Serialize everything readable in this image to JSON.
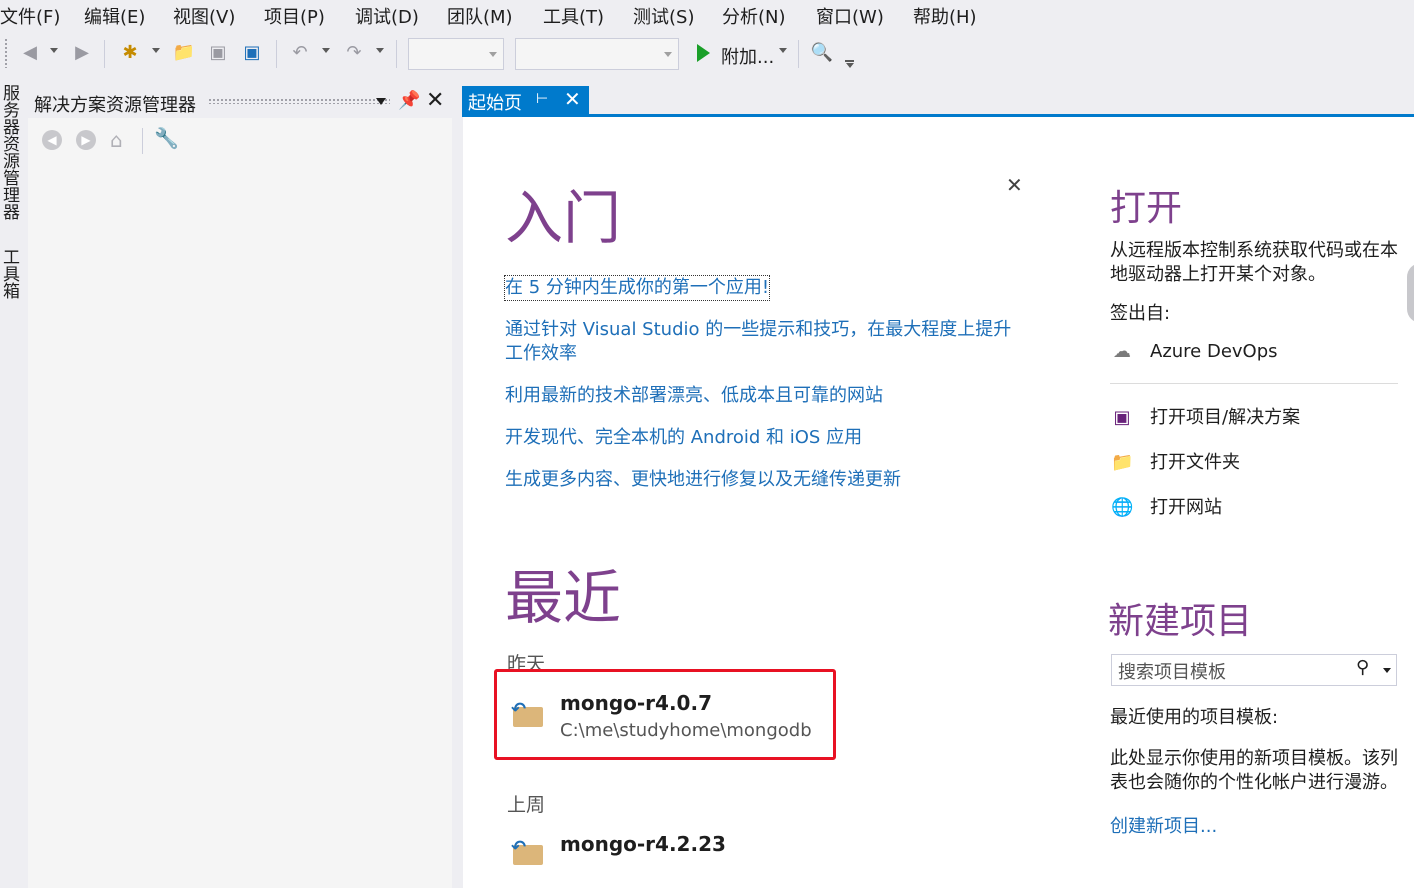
{
  "menu": [
    "文件(F)",
    "编辑(E)",
    "视图(V)",
    "项目(P)",
    "调试(D)",
    "团队(M)",
    "工具(T)",
    "测试(S)",
    "分析(N)",
    "窗口(W)",
    "帮助(H)"
  ],
  "toolbar": {
    "run_label": "附加..."
  },
  "left_strip": {
    "server_explorer": "服务器资源管理器",
    "toolbox": "工具箱"
  },
  "solution_explorer": {
    "title": "解决方案资源管理器"
  },
  "tab": {
    "label": "起始页"
  },
  "start": {
    "getting_started": {
      "heading": "入门",
      "links": [
        "在 5 分钟内生成你的第一个应用!",
        "通过针对 Visual Studio 的一些提示和技巧，在最大程度上提升",
        "工作效率",
        "利用最新的技术部署漂亮、低成本且可靠的网站",
        "开发现代、完全本机的 Android 和 iOS 应用",
        "生成更多内容、更快地进行修复以及无缝传递更新"
      ]
    },
    "recent": {
      "heading": "最近",
      "groups": [
        {
          "label": "昨天",
          "items": [
            {
              "name": "mongo-r4.0.7",
              "path": "C:\\me\\studyhome\\mongodb"
            }
          ]
        },
        {
          "label": "上周",
          "items": [
            {
              "name": "mongo-r4.2.23",
              "path": ""
            }
          ]
        }
      ]
    },
    "open": {
      "heading": "打开",
      "desc_line1": "从远程版本控制系统获取代码或在本",
      "desc_line2": "地驱动器上打开某个对象。",
      "checkout_label": "签出自:",
      "azure": "Azure DevOps",
      "actions": [
        "打开项目/解决方案",
        "打开文件夹",
        "打开网站"
      ]
    },
    "new_project": {
      "heading": "新建项目",
      "search_placeholder": "搜索项目模板",
      "recent_templates_label": "最近使用的项目模板:",
      "info_line1": "此处显示你使用的新项目模板。该列",
      "info_line2": "表也会随你的个性化帐户进行漫游。",
      "create_link": "创建新项目..."
    }
  },
  "colors": {
    "accent": "#007acc",
    "heading": "#68217a",
    "link": "#1e6fb8",
    "highlight_box": "#e81123"
  }
}
